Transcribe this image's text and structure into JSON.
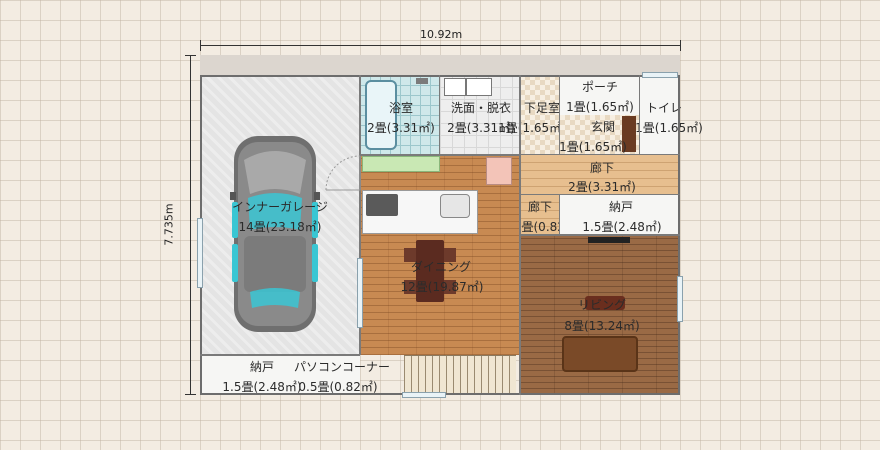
{
  "dimensions": {
    "width": "10.92m",
    "height": "7.735m"
  },
  "rooms": {
    "garage": {
      "name": "インナーガレージ",
      "area": "14畳(23.18㎡)"
    },
    "bath": {
      "name": "浴室",
      "area": "2畳(3.31㎡)"
    },
    "washroom": {
      "name": "洗面・脱衣",
      "area": "2畳(3.31㎡)"
    },
    "shoe_room": {
      "name": "下足室",
      "area": "1畳(1.65㎡)"
    },
    "porch": {
      "name": "ポーチ",
      "area": "1畳(1.65㎡)"
    },
    "toilet": {
      "name": "トイレ",
      "area": "1畳(1.65㎡)"
    },
    "entrance": {
      "name": "玄関",
      "area": "1畳(1.65㎡)"
    },
    "hall_upper": {
      "name": "廊下",
      "area": "2畳(3.31㎡)"
    },
    "hall_small": {
      "name": "廊下",
      "area": "0.5畳(0.82㎡)"
    },
    "storage_right": {
      "name": "納戸",
      "area": "1.5畳(2.48㎡)"
    },
    "dining": {
      "name": "ダイニング",
      "area": "12畳(19.87㎡)"
    },
    "living": {
      "name": "リビング",
      "area": "8畳(13.24㎡)"
    },
    "storage_bottom": {
      "name": "納戸",
      "area": "1.5畳(2.48㎡)"
    },
    "pc_corner": {
      "name": "パソコンコーナー",
      "area": "0.5畳(0.82㎡)"
    }
  },
  "colors": {
    "wall": "#6d6d6d",
    "floor_dark": "#9a6a45",
    "floor_mid": "#c88a52",
    "floor_light": "#e7bf8f",
    "car": "#6f6f6f",
    "glass": "#39c6d3"
  }
}
